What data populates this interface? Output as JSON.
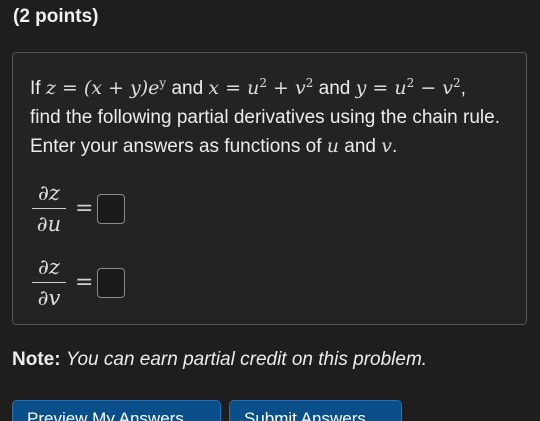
{
  "header": {
    "points_label": "(2 points)"
  },
  "problem": {
    "if_word": "If",
    "z_def": "z = (x + y)e",
    "z_exp": "y",
    "and_1": "and",
    "x_def": "x = u",
    "x_exp1": "2",
    "x_plus": " + v",
    "x_exp2": "2",
    "and_2": "and",
    "y_def": "y = u",
    "y_exp1": "2",
    "y_minus": " − v",
    "y_exp2": "2",
    "comma": ",",
    "line2": "find the following partial derivatives using the chain rule.",
    "line3_pre": "Enter your answers as functions of",
    "u_var": "u",
    "and_3": "and",
    "v_var": "v",
    "period": "."
  },
  "derivatives": [
    {
      "numerator": "∂z",
      "denominator": "∂u",
      "equals": "=",
      "answer_value": ""
    },
    {
      "numerator": "∂z",
      "denominator": "∂v",
      "equals": "=",
      "answer_value": ""
    }
  ],
  "note": {
    "label": "Note:",
    "text": "You can earn partial credit on this problem."
  },
  "buttons": {
    "preview_label": "Preview My Answers",
    "submit_label": "Submit Answers"
  },
  "colors": {
    "background": "#1e1e1e",
    "box_border": "#555555",
    "button_bg": "#0b4f8a"
  }
}
